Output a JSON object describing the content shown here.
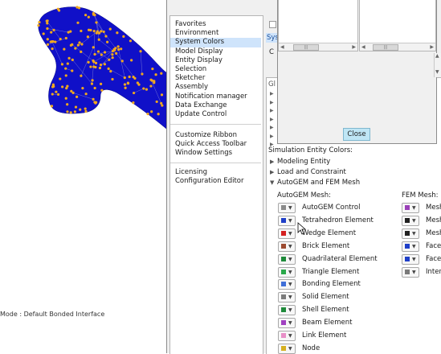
{
  "status_bar": {
    "text": "Mode : Default Bonded Interface"
  },
  "nav": {
    "group1": [
      "Favorites",
      "Environment",
      "System Colors",
      "Model Display",
      "Entity Display",
      "Selection",
      "Sketcher",
      "Assembly",
      "Notification manager",
      "Data Exchange",
      "Update Control"
    ],
    "selected": "System Colors",
    "group2": [
      "Customize Ribbon",
      "Quick Access Toolbar",
      "Window Settings"
    ],
    "group3": [
      "Licensing",
      "Configuration Editor"
    ]
  },
  "top_partial": {
    "label": "Sys",
    "label2": "C",
    "gl": "Gl"
  },
  "popup": {
    "close_label": "Close"
  },
  "section": {
    "title": "Simulation Entity Colors:",
    "nodes": [
      {
        "label": "Modeling Entity",
        "expanded": false
      },
      {
        "label": "Load and Constraint",
        "expanded": false
      },
      {
        "label": "AutoGEM and FEM Mesh",
        "expanded": true
      }
    ],
    "autogem_header": "AutoGEM Mesh:",
    "fem_header": "FEM Mesh:"
  },
  "autogem_items": [
    {
      "label": "AutoGEM Control",
      "color": "#8a8a8a"
    },
    {
      "label": "Tetrahedron Element",
      "color": "#1f3fc8"
    },
    {
      "label": "Wedge Element",
      "color": "#d42020"
    },
    {
      "label": "Brick Element",
      "color": "#9c4a30"
    },
    {
      "label": "Quadrilateral Element",
      "color": "#1e8a3a"
    },
    {
      "label": "Triangle Element",
      "color": "#2aa84a"
    },
    {
      "label": "Bonding Element",
      "color": "#3f6fd8"
    },
    {
      "label": "Solid Element",
      "color": "#7a7a7a"
    },
    {
      "label": "Shell Element",
      "color": "#1e8a3a"
    },
    {
      "label": "Beam Element",
      "color": "#a040c0"
    },
    {
      "label": "Link Element",
      "color": "#e890c8"
    },
    {
      "label": "Node",
      "color": "#d6b020"
    }
  ],
  "fem_items": [
    {
      "label": "Mesh",
      "color": "#9a40b8"
    },
    {
      "label": "Mesh",
      "color": "#202020"
    },
    {
      "label": "Mesh",
      "color": "#202020"
    },
    {
      "label": "Face",
      "color": "#1f3fc8"
    },
    {
      "label": "Face",
      "color": "#1f3fc8"
    },
    {
      "label": "Intern",
      "color": "#7a7a7a"
    }
  ],
  "icons": {
    "cursor": "mouse-pointer-icon",
    "dropdown": "chevron-down-icon",
    "expand": "triangle-right-icon",
    "collapse": "triangle-down-icon"
  }
}
